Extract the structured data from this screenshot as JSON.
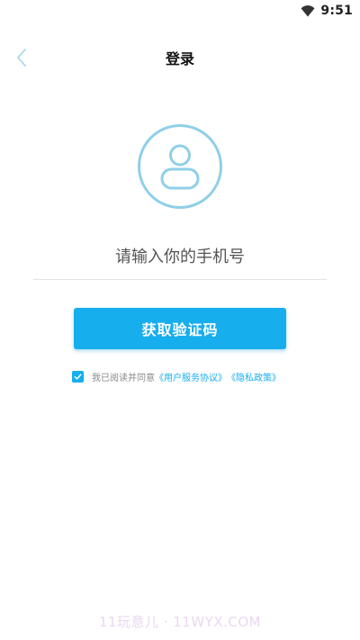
{
  "status_bar": {
    "time": "9:51",
    "wifi_icon": "wifi-icon"
  },
  "header": {
    "title": "登录",
    "back_icon": "chevron-left-icon"
  },
  "avatar": {
    "icon": "user-avatar-icon",
    "ring_color": "#8fcfe8"
  },
  "phone_input": {
    "placeholder": "请输入你的手机号",
    "value": ""
  },
  "primary_button": {
    "label": "获取验证码",
    "color": "#17aeee"
  },
  "agreement": {
    "checked": true,
    "text": "我已阅读并同意",
    "user_agreement_link": "《用户服务协议》",
    "privacy_link": "《隐私政策》",
    "link_color": "#17aeee"
  },
  "watermark": {
    "text": "11玩意儿 · 11WYX.COM"
  }
}
